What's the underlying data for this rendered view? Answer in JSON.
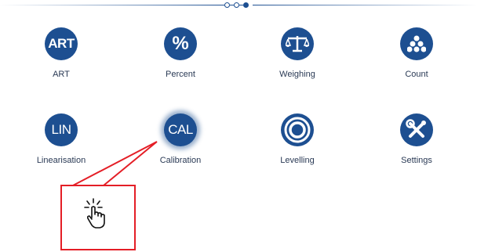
{
  "pager": {
    "pages": 3,
    "current": 3
  },
  "menu": {
    "items": [
      {
        "id": "art",
        "glyph": "ART",
        "label": "ART",
        "icon": "art-icon"
      },
      {
        "id": "percent",
        "glyph": "%",
        "label": "Percent",
        "icon": "percent-icon"
      },
      {
        "id": "weighing",
        "glyph": "",
        "label": "Weighing",
        "icon": "scale-icon"
      },
      {
        "id": "count",
        "glyph": "",
        "label": "Count",
        "icon": "count-dots-icon"
      },
      {
        "id": "linearisation",
        "glyph": "LIN",
        "label": "Linearisation",
        "icon": "lin-icon"
      },
      {
        "id": "calibration",
        "glyph": "CAL",
        "label": "Calibration",
        "icon": "cal-icon",
        "selected": true
      },
      {
        "id": "levelling",
        "glyph": "",
        "label": "Levelling",
        "icon": "level-bubble-icon"
      },
      {
        "id": "settings",
        "glyph": "",
        "label": "Settings",
        "icon": "wrench-screwdriver-icon"
      }
    ]
  },
  "callout": {
    "icon": "tap-hand-icon",
    "highlight_color": "#e41e26"
  },
  "colors": {
    "icon_blue": "#1d4f91",
    "label_text": "#2a3a55"
  }
}
